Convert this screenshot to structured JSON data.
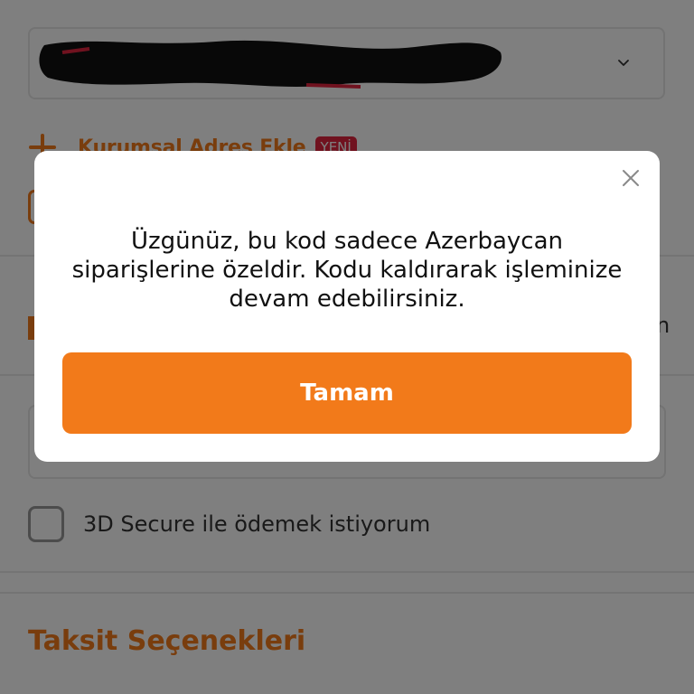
{
  "address_section": {
    "new_corporate_address_label": "Kurumsal Adres Ekle",
    "new_badge": "YENİ"
  },
  "partial_text": "n",
  "payment": {
    "secure_3d_label": "3D Secure ile ödemek istiyorum"
  },
  "installments": {
    "title": "Taksit Seçenekleri"
  },
  "modal": {
    "message": "Üzgünüz, bu kod sadece Azerbaycan siparişlerine özeldir. Kodu kaldırarak işleminize devam edebilirsiniz.",
    "ok_label": "Tamam"
  },
  "colors": {
    "accent": "#f27a1a",
    "badge": "#e1253f",
    "overlay": "rgba(0,0,0,0.5)"
  },
  "icons": [
    "chevron-down-icon",
    "plus-icon",
    "close-icon"
  ]
}
